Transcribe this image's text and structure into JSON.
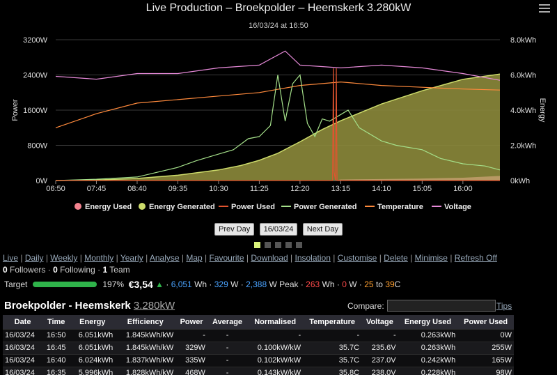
{
  "chart_data": {
    "type": "area",
    "title": "Live Production – Broekpolder – Heemskerk 3.280kW",
    "subtitle": "16/03/24 at 16:50",
    "ylabel_left": "Power",
    "ylabel_right": "Energy",
    "ylim_left": [
      0,
      3200
    ],
    "ylim_right": [
      0,
      8.0
    ],
    "yticks_left": [
      "0W",
      "800W",
      "1600W",
      "2400W",
      "3200W"
    ],
    "yticks_right": [
      "0kWh",
      "2.0kWh",
      "4.0kWh",
      "6.0kWh",
      "8.0kWh"
    ],
    "xticks": [
      "06:50",
      "07:45",
      "08:40",
      "09:35",
      "10:30",
      "11:25",
      "12:20",
      "13:15",
      "14:10",
      "15:05",
      "16:00"
    ],
    "legend_position": "bottom",
    "grid": true,
    "series": [
      {
        "name": "Energy Used",
        "color": "#f4838f",
        "unit": "kWh",
        "x": [
          "06:50",
          "13:05",
          "13:15",
          "14:00",
          "15:00",
          "16:00",
          "16:50"
        ],
        "values": [
          0,
          0,
          0.06,
          0.08,
          0.11,
          0.16,
          0.263
        ]
      },
      {
        "name": "Energy Generated",
        "color": "#cddc6b",
        "unit": "kWh",
        "x": [
          "06:50",
          "07:45",
          "08:40",
          "09:35",
          "10:30",
          "11:00",
          "11:25",
          "11:50",
          "12:20",
          "12:50",
          "13:15",
          "14:10",
          "15:05",
          "16:00",
          "16:50"
        ],
        "values": [
          0,
          0.03,
          0.12,
          0.3,
          0.6,
          0.85,
          1.15,
          1.55,
          2.2,
          2.9,
          3.4,
          4.35,
          5.1,
          5.75,
          6.051
        ]
      },
      {
        "name": "Power Used",
        "color": "#e3542f",
        "unit": "W",
        "x": [
          "06:50",
          "13:04",
          "13:05",
          "13:06",
          "13:08",
          "13:09",
          "13:10",
          "16:50"
        ],
        "values": [
          0,
          0,
          2550,
          200,
          0,
          2550,
          0,
          0
        ]
      },
      {
        "name": "Power Generated",
        "color": "#a5e08a",
        "unit": "W",
        "x": [
          "06:50",
          "07:45",
          "08:40",
          "09:00",
          "09:35",
          "10:00",
          "10:30",
          "10:50",
          "11:10",
          "11:25",
          "11:40",
          "11:50",
          "12:00",
          "12:10",
          "12:20",
          "12:30",
          "12:40",
          "12:50",
          "13:00",
          "13:15",
          "13:25",
          "13:40",
          "14:10",
          "14:30",
          "15:05",
          "15:30",
          "16:00",
          "16:30",
          "16:50"
        ],
        "values": [
          0,
          30,
          80,
          160,
          300,
          450,
          600,
          700,
          950,
          1000,
          1250,
          2400,
          1350,
          2200,
          2400,
          1300,
          1000,
          1400,
          1350,
          1500,
          1600,
          1200,
          900,
          800,
          700,
          500,
          380,
          330,
          240
        ]
      },
      {
        "name": "Temperature",
        "color": "#ff8a3c",
        "unit": "C",
        "x": [
          "06:50",
          "07:45",
          "08:40",
          "09:35",
          "10:30",
          "11:25",
          "12:20",
          "13:15",
          "14:10",
          "15:05",
          "16:00",
          "16:50"
        ],
        "values": [
          25,
          29,
          32,
          33,
          34,
          35,
          37,
          38,
          37,
          36.5,
          36,
          35.7
        ]
      },
      {
        "name": "Voltage",
        "color": "#e78ad9",
        "unit": "V",
        "x": [
          "06:50",
          "07:45",
          "08:40",
          "09:35",
          "10:30",
          "11:25",
          "12:00",
          "12:20",
          "13:15",
          "14:10",
          "15:05",
          "16:00",
          "16:50"
        ],
        "values": [
          237,
          236,
          238,
          238,
          240,
          241,
          246,
          241,
          240,
          241,
          240,
          238,
          235.6
        ]
      }
    ]
  },
  "header": {
    "title": "Live Production – Broekpolder – Heemskerk 3.280kW",
    "subtitle": "16/03/24 at 16:50"
  },
  "legend": [
    "Energy Used",
    "Energy Generated",
    "Power Used",
    "Power Generated",
    "Temperature",
    "Voltage"
  ],
  "nav": {
    "prev": "Prev Day",
    "date": "16/03/24",
    "next": "Next Day"
  },
  "links": [
    "Live",
    "Daily",
    "Weekly",
    "Monthly",
    "Yearly",
    "Analyse",
    "Map",
    "Favourite",
    "Download",
    "Insolation",
    "Customise",
    "Delete",
    "Minimise",
    "Refresh Off"
  ],
  "followers": {
    "followers_count": "0",
    "followers_label": "Followers",
    "following_count": "0",
    "following_label": "Following",
    "team_count": "1",
    "team_label": "Team"
  },
  "target": {
    "label": "Target",
    "percent": "197%",
    "money": "€3,54",
    "arrow": "▲",
    "energy": "6,051",
    "wh": "Wh",
    "power": "329",
    "w1": "W",
    "peak": "2,388",
    "w_peak": "W Peak",
    "used_energy": "263",
    "wh2": "Wh",
    "used_power": "0",
    "w2": "W",
    "temp_min": "25",
    "to": "to",
    "temp_max": "39",
    "c": "C"
  },
  "site": {
    "name": "Broekpolder - Heemskerk",
    "size": "3.280kW"
  },
  "compare": {
    "label": "Compare:",
    "tips": "Tips"
  },
  "table": {
    "headers": [
      "Date",
      "Time",
      "Energy",
      "Efficiency",
      "Power",
      "Average",
      "Normalised",
      "Temperature",
      "Voltage",
      "Energy Used",
      "Power Used"
    ],
    "rows": [
      [
        "16/03/24",
        "16:50",
        "6.051kWh",
        "1.845kWh/kW",
        "-",
        "-",
        "-",
        "-",
        "-",
        "0.263kWh",
        "0W"
      ],
      [
        "16/03/24",
        "16:45",
        "6.051kWh",
        "1.845kWh/kW",
        "329W",
        "-",
        "0.100kW/kW",
        "35.7C",
        "235.6V",
        "0.263kWh",
        "255W"
      ],
      [
        "16/03/24",
        "16:40",
        "6.024kWh",
        "1.837kWh/kW",
        "335W",
        "-",
        "0.102kW/kW",
        "35.7C",
        "237.0V",
        "0.242kWh",
        "165W"
      ],
      [
        "16/03/24",
        "16:35",
        "5.996kWh",
        "1.828kWh/kW",
        "468W",
        "-",
        "0.143kW/kW",
        "35.8C",
        "238.0V",
        "0.228kWh",
        "98W"
      ]
    ]
  }
}
